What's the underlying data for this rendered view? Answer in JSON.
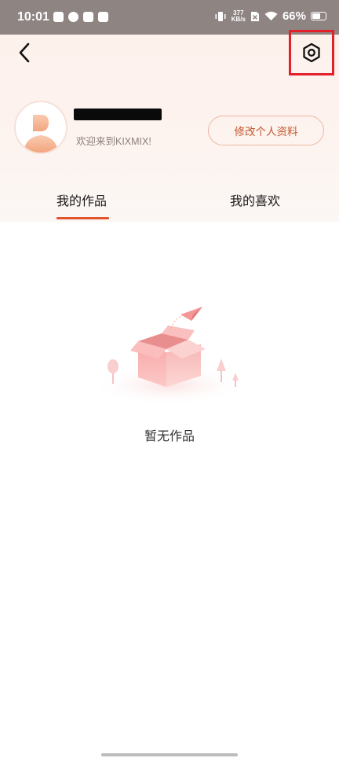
{
  "status_bar": {
    "time": "10:01",
    "net_speed_value": "377",
    "net_speed_unit": "KB/s",
    "battery_percent": "66%",
    "battery_level": 0.66
  },
  "header": {
    "welcome_text": "欢迎来到KIXMIX!",
    "edit_profile_label": "修改个人资料"
  },
  "tabs": [
    {
      "label": "我的作品",
      "active": true
    },
    {
      "label": "我的喜欢",
      "active": false
    }
  ],
  "empty_state": {
    "text": "暂无作品"
  },
  "colors": {
    "accent": "#e1542c",
    "highlight_box": "#e3202a",
    "status_bar_bg": "#8e8583"
  },
  "icons": {
    "back": "chevron-left-icon",
    "settings": "hexagon-settings-icon",
    "empty": "open-box-paper-plane-illustration"
  }
}
